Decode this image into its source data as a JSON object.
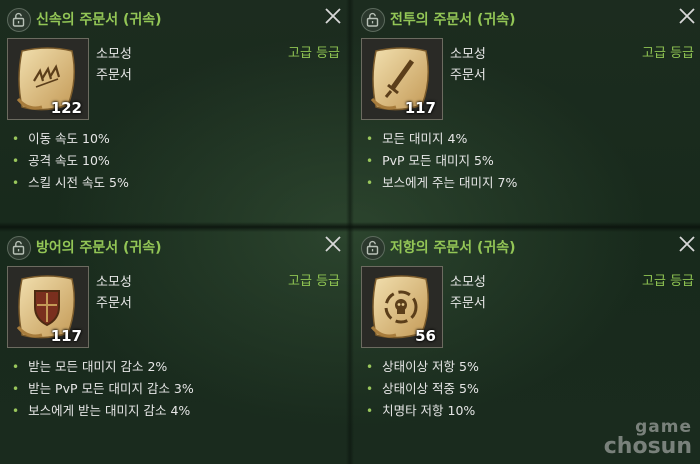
{
  "panels": [
    {
      "title": "신속의 주문서 (귀속)",
      "type_line1": "소모성",
      "type_line2": "주문서",
      "grade": "고급 등급",
      "count": "122",
      "icon": "wing-scroll-icon",
      "stats": [
        "이동 속도 10%",
        "공격 속도 10%",
        "스킬 시전 속도 5%"
      ]
    },
    {
      "title": "전투의 주문서 (귀속)",
      "type_line1": "소모성",
      "type_line2": "주문서",
      "grade": "고급 등급",
      "count": "117",
      "icon": "sword-scroll-icon",
      "stats": [
        "모든 대미지 4%",
        "PvP 모든 대미지 5%",
        "보스에게 주는 대미지 7%"
      ]
    },
    {
      "title": "방어의 주문서 (귀속)",
      "type_line1": "소모성",
      "type_line2": "주문서",
      "grade": "고급 등급",
      "count": "117",
      "icon": "shield-scroll-icon",
      "stats": [
        "받는 모든 대미지 감소 2%",
        "받는 PvP 모든 대미지 감소 3%",
        "보스에게 받는 대미지 감소 4%"
      ]
    },
    {
      "title": "저항의 주문서 (귀속)",
      "type_line1": "소모성",
      "type_line2": "주문서",
      "grade": "고급 등급",
      "count": "56",
      "icon": "skull-scroll-icon",
      "stats": [
        "상태이상 저항 5%",
        "상태이상 적중 5%",
        "치명타 저항 10%"
      ]
    }
  ],
  "watermark": {
    "line1": "game",
    "line2": "chosun"
  },
  "colors": {
    "title": "#93c656",
    "grade": "#8fc452",
    "bullet": "#9ac75c",
    "background": "#16241a"
  }
}
